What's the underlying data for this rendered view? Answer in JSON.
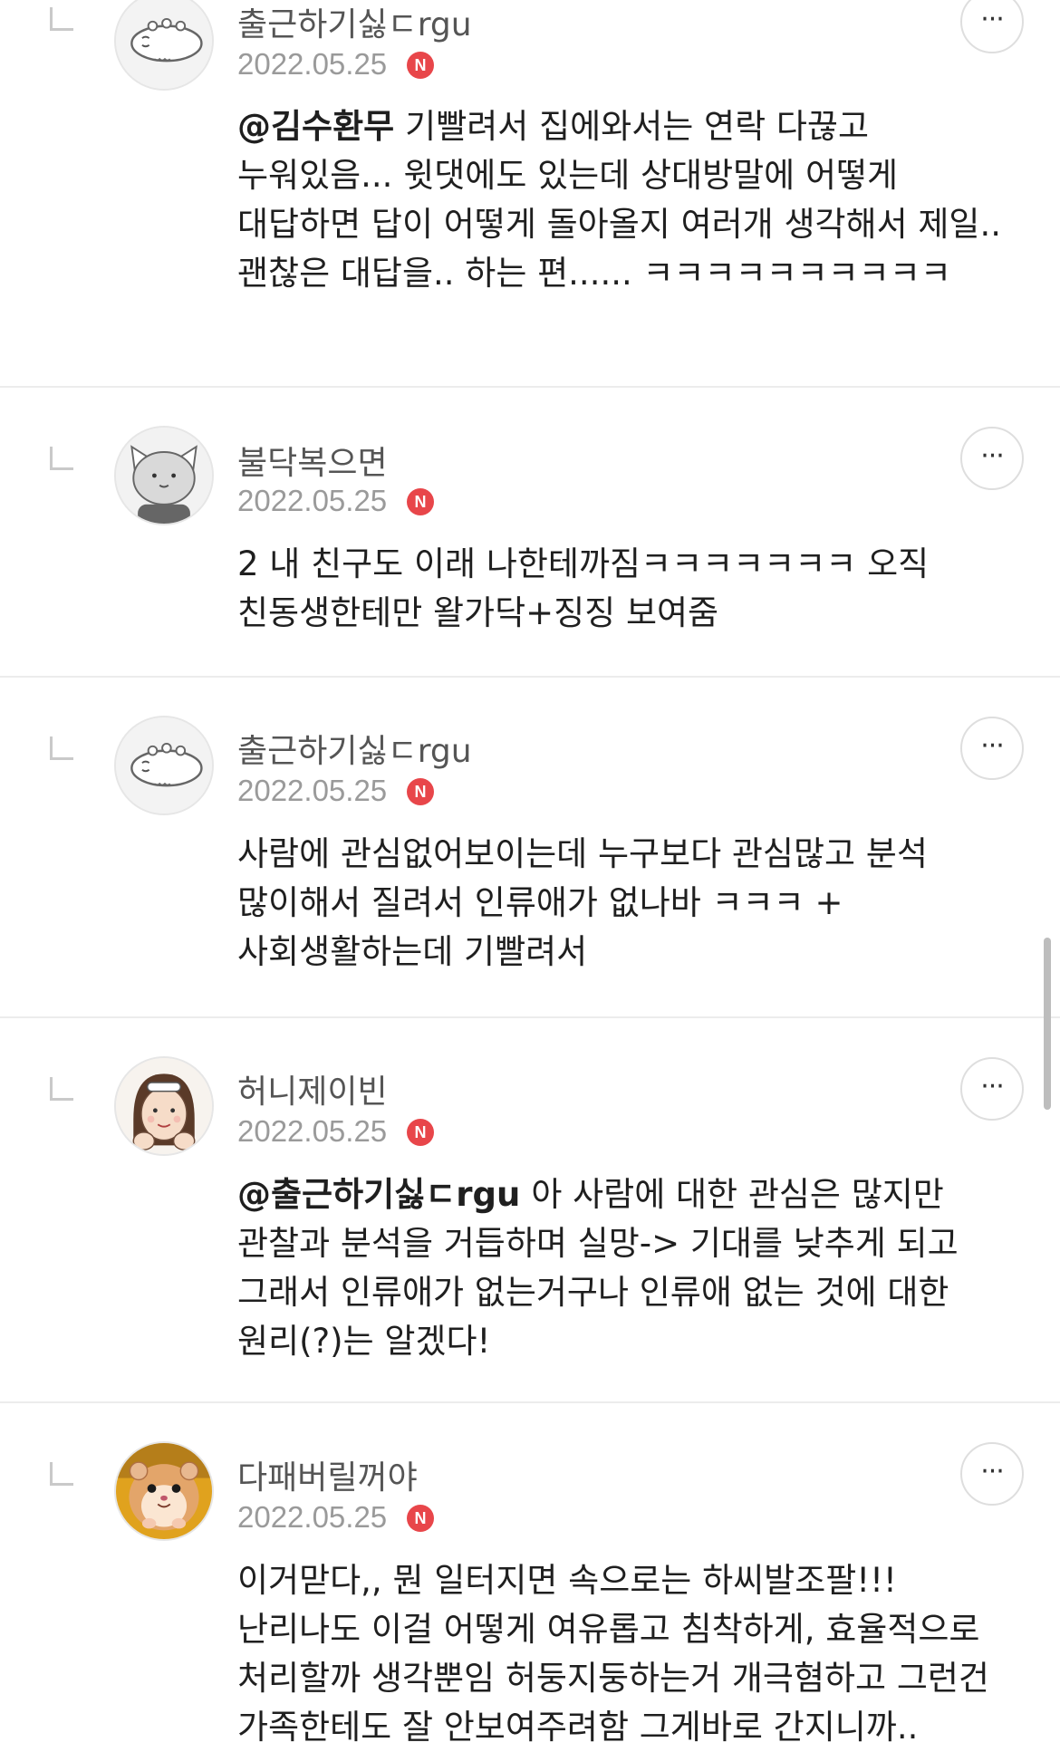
{
  "comments": [
    {
      "nickname": "출근하기싫ㄷrgu",
      "date": "2022.05.25",
      "badge": "N",
      "mention": "@김수환무",
      "text": "기빨려서 집에와서는 연락 다끊고 누워있음... 윗댓에도 있는데 상대방말에 어떻게 대답하면 답이 어떻게 돌아올지 여러개 생각해서 제일.. 괜찮은 대답을.. 하는 편...... ㅋㅋㅋㅋㅋㅋㅋㅋㅋㅋ",
      "avatar_icon": "lizard-avatar-icon"
    },
    {
      "nickname": "불닥복으면",
      "date": "2022.05.25",
      "badge": "N",
      "mention": "",
      "text": "2 내 친구도 이래 나한테까짐ㅋㅋㅋㅋㅋㅋㅋ 오직 친동생한테만 왈가닥+징징 보여줌",
      "avatar_icon": "cat-avatar-icon"
    },
    {
      "nickname": "출근하기싫ㄷrgu",
      "date": "2022.05.25",
      "badge": "N",
      "mention": "",
      "text": "사람에 관심없어보이는데 누구보다 관심많고 분석 많이해서 질려서 인류애가 없나바 ㅋㅋㅋ + 사회생활하는데 기빨려서",
      "avatar_icon": "lizard-avatar-icon"
    },
    {
      "nickname": "허니제이빈",
      "date": "2022.05.25",
      "badge": "N",
      "mention": "@출근하기싫ㄷrgu",
      "text": "아 사람에 대한 관심은 많지만 관찰과 분석을 거듭하며 실망-> 기대를 낮추게 되고 그래서 인류애가 없는거구나 인류애 없는 것에 대한 원리(?)는 알겠다!",
      "avatar_icon": "girl-avatar-icon"
    },
    {
      "nickname": "다패버릴꺼야",
      "date": "2022.05.25",
      "badge": "N",
      "mention": "",
      "text": "이거맏다,, 뭔 일터지면 속으로는 하씨발조팔!!!난리나도 이걸 어떻게 여유롭고 침착하게, 효율적으로 처리할까 생각뿐임 허둥지둥하는거 개극혐하고 그런건 가족한테도 잘 안보여주려함 그게바로 간지니까..",
      "avatar_icon": "hamster-avatar-icon"
    }
  ],
  "more_button": {
    "label": "···",
    "icon": "more-options-icon"
  },
  "colors": {
    "badge": "#e8464a",
    "date": "#9a9a9a",
    "nickname": "#555555",
    "divider": "#ececec"
  }
}
